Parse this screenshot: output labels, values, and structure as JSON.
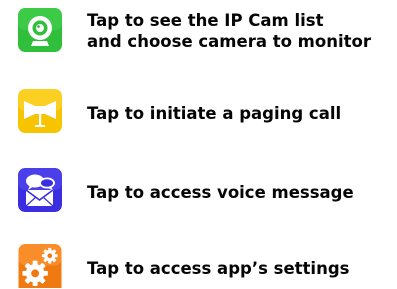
{
  "rows": [
    {
      "icon": "ip-camera-icon",
      "icon_color": "#2fbf3a",
      "line1": "Tap to see the IP Cam list",
      "line2": "and choose camera to monitor"
    },
    {
      "icon": "paging-speaker-icon",
      "icon_color": "#f6c400",
      "line1": "Tap to initiate a paging call"
    },
    {
      "icon": "voice-message-icon",
      "icon_color": "#3a2ee0",
      "line1": "Tap to access voice message"
    },
    {
      "icon": "gear-settings-icon",
      "icon_color": "#f07a12",
      "line1": "Tap to access app’s settings"
    }
  ]
}
